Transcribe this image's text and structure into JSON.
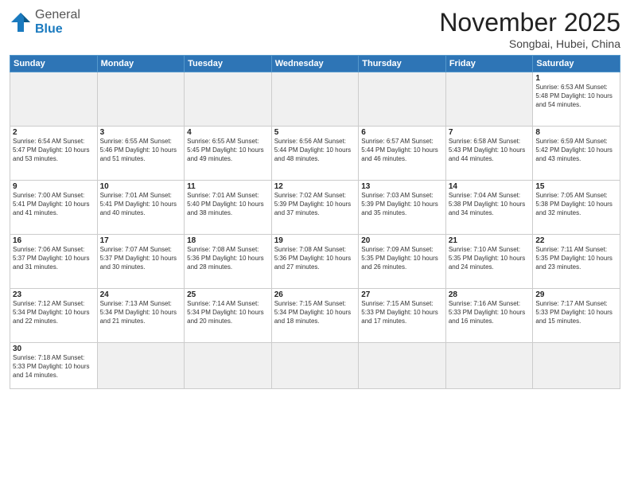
{
  "header": {
    "logo_general": "General",
    "logo_blue": "Blue",
    "month_title": "November 2025",
    "location": "Songbai, Hubei, China"
  },
  "days_of_week": [
    "Sunday",
    "Monday",
    "Tuesday",
    "Wednesday",
    "Thursday",
    "Friday",
    "Saturday"
  ],
  "weeks": [
    [
      {
        "day": "",
        "info": ""
      },
      {
        "day": "",
        "info": ""
      },
      {
        "day": "",
        "info": ""
      },
      {
        "day": "",
        "info": ""
      },
      {
        "day": "",
        "info": ""
      },
      {
        "day": "",
        "info": ""
      },
      {
        "day": "1",
        "info": "Sunrise: 6:53 AM\nSunset: 5:48 PM\nDaylight: 10 hours\nand 54 minutes."
      }
    ],
    [
      {
        "day": "2",
        "info": "Sunrise: 6:54 AM\nSunset: 5:47 PM\nDaylight: 10 hours\nand 53 minutes."
      },
      {
        "day": "3",
        "info": "Sunrise: 6:55 AM\nSunset: 5:46 PM\nDaylight: 10 hours\nand 51 minutes."
      },
      {
        "day": "4",
        "info": "Sunrise: 6:55 AM\nSunset: 5:45 PM\nDaylight: 10 hours\nand 49 minutes."
      },
      {
        "day": "5",
        "info": "Sunrise: 6:56 AM\nSunset: 5:44 PM\nDaylight: 10 hours\nand 48 minutes."
      },
      {
        "day": "6",
        "info": "Sunrise: 6:57 AM\nSunset: 5:44 PM\nDaylight: 10 hours\nand 46 minutes."
      },
      {
        "day": "7",
        "info": "Sunrise: 6:58 AM\nSunset: 5:43 PM\nDaylight: 10 hours\nand 44 minutes."
      },
      {
        "day": "8",
        "info": "Sunrise: 6:59 AM\nSunset: 5:42 PM\nDaylight: 10 hours\nand 43 minutes."
      }
    ],
    [
      {
        "day": "9",
        "info": "Sunrise: 7:00 AM\nSunset: 5:41 PM\nDaylight: 10 hours\nand 41 minutes."
      },
      {
        "day": "10",
        "info": "Sunrise: 7:01 AM\nSunset: 5:41 PM\nDaylight: 10 hours\nand 40 minutes."
      },
      {
        "day": "11",
        "info": "Sunrise: 7:01 AM\nSunset: 5:40 PM\nDaylight: 10 hours\nand 38 minutes."
      },
      {
        "day": "12",
        "info": "Sunrise: 7:02 AM\nSunset: 5:39 PM\nDaylight: 10 hours\nand 37 minutes."
      },
      {
        "day": "13",
        "info": "Sunrise: 7:03 AM\nSunset: 5:39 PM\nDaylight: 10 hours\nand 35 minutes."
      },
      {
        "day": "14",
        "info": "Sunrise: 7:04 AM\nSunset: 5:38 PM\nDaylight: 10 hours\nand 34 minutes."
      },
      {
        "day": "15",
        "info": "Sunrise: 7:05 AM\nSunset: 5:38 PM\nDaylight: 10 hours\nand 32 minutes."
      }
    ],
    [
      {
        "day": "16",
        "info": "Sunrise: 7:06 AM\nSunset: 5:37 PM\nDaylight: 10 hours\nand 31 minutes."
      },
      {
        "day": "17",
        "info": "Sunrise: 7:07 AM\nSunset: 5:37 PM\nDaylight: 10 hours\nand 30 minutes."
      },
      {
        "day": "18",
        "info": "Sunrise: 7:08 AM\nSunset: 5:36 PM\nDaylight: 10 hours\nand 28 minutes."
      },
      {
        "day": "19",
        "info": "Sunrise: 7:08 AM\nSunset: 5:36 PM\nDaylight: 10 hours\nand 27 minutes."
      },
      {
        "day": "20",
        "info": "Sunrise: 7:09 AM\nSunset: 5:35 PM\nDaylight: 10 hours\nand 26 minutes."
      },
      {
        "day": "21",
        "info": "Sunrise: 7:10 AM\nSunset: 5:35 PM\nDaylight: 10 hours\nand 24 minutes."
      },
      {
        "day": "22",
        "info": "Sunrise: 7:11 AM\nSunset: 5:35 PM\nDaylight: 10 hours\nand 23 minutes."
      }
    ],
    [
      {
        "day": "23",
        "info": "Sunrise: 7:12 AM\nSunset: 5:34 PM\nDaylight: 10 hours\nand 22 minutes."
      },
      {
        "day": "24",
        "info": "Sunrise: 7:13 AM\nSunset: 5:34 PM\nDaylight: 10 hours\nand 21 minutes."
      },
      {
        "day": "25",
        "info": "Sunrise: 7:14 AM\nSunset: 5:34 PM\nDaylight: 10 hours\nand 20 minutes."
      },
      {
        "day": "26",
        "info": "Sunrise: 7:15 AM\nSunset: 5:34 PM\nDaylight: 10 hours\nand 18 minutes."
      },
      {
        "day": "27",
        "info": "Sunrise: 7:15 AM\nSunset: 5:33 PM\nDaylight: 10 hours\nand 17 minutes."
      },
      {
        "day": "28",
        "info": "Sunrise: 7:16 AM\nSunset: 5:33 PM\nDaylight: 10 hours\nand 16 minutes."
      },
      {
        "day": "29",
        "info": "Sunrise: 7:17 AM\nSunset: 5:33 PM\nDaylight: 10 hours\nand 15 minutes."
      }
    ],
    [
      {
        "day": "30",
        "info": "Sunrise: 7:18 AM\nSunset: 5:33 PM\nDaylight: 10 hours\nand 14 minutes."
      },
      {
        "day": "",
        "info": ""
      },
      {
        "day": "",
        "info": ""
      },
      {
        "day": "",
        "info": ""
      },
      {
        "day": "",
        "info": ""
      },
      {
        "day": "",
        "info": ""
      },
      {
        "day": "",
        "info": ""
      }
    ]
  ]
}
